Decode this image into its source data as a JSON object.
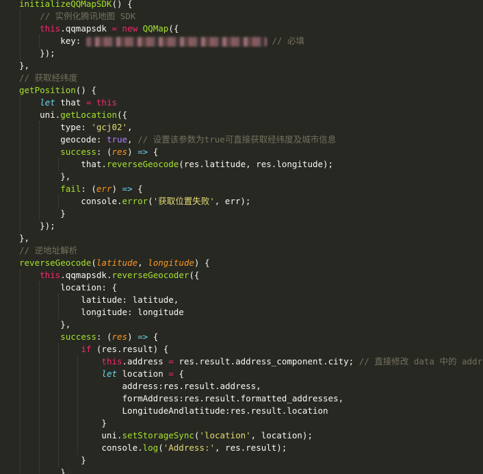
{
  "editor": {
    "theme_colors": {
      "background": "#272822",
      "keyword": "#f92672",
      "function": "#a6e22e",
      "string": "#e6db74",
      "comment": "#75715e",
      "boolean": "#ae81ff",
      "storage": "#66d9ef",
      "parameter": "#fd971f",
      "text": "#f8f8f2"
    },
    "lines": [
      [
        {
          "t": "fn",
          "v": "initializeQQMapSDK"
        },
        {
          "t": "plain",
          "v": "() {"
        }
      ],
      [
        {
          "t": "plain",
          "v": "    "
        },
        {
          "t": "cm",
          "v": "// 实例化腾讯地图 SDK"
        }
      ],
      [
        {
          "t": "plain",
          "v": "    "
        },
        {
          "t": "kw",
          "v": "this"
        },
        {
          "t": "plain",
          "v": ".qqmapsdk "
        },
        {
          "t": "kw",
          "v": "="
        },
        {
          "t": "plain",
          "v": " "
        },
        {
          "t": "kw",
          "v": "new"
        },
        {
          "t": "plain",
          "v": " "
        },
        {
          "t": "fn",
          "v": "QQMap"
        },
        {
          "t": "plain",
          "v": "({"
        }
      ],
      [
        {
          "t": "plain",
          "v": "        key: "
        },
        {
          "t": "redact",
          "v": "redacted key"
        },
        {
          "t": "plain",
          "v": " "
        },
        {
          "t": "cm",
          "v": "// 必填"
        }
      ],
      [
        {
          "t": "plain",
          "v": "    });"
        }
      ],
      [
        {
          "t": "plain",
          "v": "},"
        }
      ],
      [
        {
          "t": "cm",
          "v": "// 获取经纬度"
        }
      ],
      [
        {
          "t": "fn",
          "v": "getPosition"
        },
        {
          "t": "plain",
          "v": "() {"
        }
      ],
      [
        {
          "t": "plain",
          "v": "    "
        },
        {
          "t": "sto",
          "v": "let"
        },
        {
          "t": "plain",
          "v": " that "
        },
        {
          "t": "kw",
          "v": "="
        },
        {
          "t": "plain",
          "v": " "
        },
        {
          "t": "kw",
          "v": "this"
        }
      ],
      [
        {
          "t": "plain",
          "v": "    uni."
        },
        {
          "t": "fn",
          "v": "getLocation"
        },
        {
          "t": "plain",
          "v": "({"
        }
      ],
      [
        {
          "t": "plain",
          "v": "        type: "
        },
        {
          "t": "str",
          "v": "'gcj02'"
        },
        {
          "t": "plain",
          "v": ","
        }
      ],
      [
        {
          "t": "plain",
          "v": "        geocode: "
        },
        {
          "t": "bool",
          "v": "true"
        },
        {
          "t": "plain",
          "v": ", "
        },
        {
          "t": "cm",
          "v": "// 设置该参数为true可直接获取经纬度及城市信息"
        }
      ],
      [
        {
          "t": "plain",
          "v": "        "
        },
        {
          "t": "fn",
          "v": "success"
        },
        {
          "t": "plain",
          "v": ": ("
        },
        {
          "t": "par",
          "v": "res"
        },
        {
          "t": "plain",
          "v": ") "
        },
        {
          "t": "sto",
          "v": "=>"
        },
        {
          "t": "plain",
          "v": " {"
        }
      ],
      [
        {
          "t": "plain",
          "v": "            that."
        },
        {
          "t": "fn",
          "v": "reverseGeocode"
        },
        {
          "t": "plain",
          "v": "(res.latitude, res.longitude);"
        }
      ],
      [
        {
          "t": "plain",
          "v": "        },"
        }
      ],
      [
        {
          "t": "plain",
          "v": "        "
        },
        {
          "t": "fn",
          "v": "fail"
        },
        {
          "t": "plain",
          "v": ": ("
        },
        {
          "t": "par",
          "v": "err"
        },
        {
          "t": "plain",
          "v": ") "
        },
        {
          "t": "sto",
          "v": "=>"
        },
        {
          "t": "plain",
          "v": " {"
        }
      ],
      [
        {
          "t": "plain",
          "v": "            console."
        },
        {
          "t": "fn",
          "v": "error"
        },
        {
          "t": "plain",
          "v": "("
        },
        {
          "t": "str",
          "v": "'获取位置失败'"
        },
        {
          "t": "plain",
          "v": ", err);"
        }
      ],
      [
        {
          "t": "plain",
          "v": "        }"
        }
      ],
      [
        {
          "t": "plain",
          "v": "    });"
        }
      ],
      [
        {
          "t": "plain",
          "v": "},"
        }
      ],
      [
        {
          "t": "cm",
          "v": "// 逆地址解析"
        }
      ],
      [
        {
          "t": "fn",
          "v": "reverseGeocode"
        },
        {
          "t": "plain",
          "v": "("
        },
        {
          "t": "par",
          "v": "latitude"
        },
        {
          "t": "plain",
          "v": ", "
        },
        {
          "t": "par",
          "v": "longitude"
        },
        {
          "t": "plain",
          "v": ") {"
        }
      ],
      [
        {
          "t": "plain",
          "v": "    "
        },
        {
          "t": "kw",
          "v": "this"
        },
        {
          "t": "plain",
          "v": ".qqmapsdk."
        },
        {
          "t": "fn",
          "v": "reverseGeocoder"
        },
        {
          "t": "plain",
          "v": "({"
        }
      ],
      [
        {
          "t": "plain",
          "v": "        location: {"
        }
      ],
      [
        {
          "t": "plain",
          "v": "            latitude: latitude,"
        }
      ],
      [
        {
          "t": "plain",
          "v": "            longitude: longitude"
        }
      ],
      [
        {
          "t": "plain",
          "v": "        },"
        }
      ],
      [
        {
          "t": "plain",
          "v": "        "
        },
        {
          "t": "fn",
          "v": "success"
        },
        {
          "t": "plain",
          "v": ": ("
        },
        {
          "t": "par",
          "v": "res"
        },
        {
          "t": "plain",
          "v": ") "
        },
        {
          "t": "sto",
          "v": "=>"
        },
        {
          "t": "plain",
          "v": " {"
        }
      ],
      [
        {
          "t": "plain",
          "v": "            "
        },
        {
          "t": "kw",
          "v": "if"
        },
        {
          "t": "plain",
          "v": " (res.result) {"
        }
      ],
      [
        {
          "t": "plain",
          "v": "                "
        },
        {
          "t": "kw",
          "v": "this"
        },
        {
          "t": "plain",
          "v": ".address "
        },
        {
          "t": "kw",
          "v": "="
        },
        {
          "t": "plain",
          "v": " res.result.address_component.city; "
        },
        {
          "t": "cm",
          "v": "// 直接修改 data 中的 address"
        }
      ],
      [
        {
          "t": "plain",
          "v": "                "
        },
        {
          "t": "sto",
          "v": "let"
        },
        {
          "t": "plain",
          "v": " location "
        },
        {
          "t": "kw",
          "v": "="
        },
        {
          "t": "plain",
          "v": " {"
        }
      ],
      [
        {
          "t": "plain",
          "v": "                    address:res.result.address,"
        }
      ],
      [
        {
          "t": "plain",
          "v": "                    formAddress:res.result.formatted_addresses,"
        }
      ],
      [
        {
          "t": "plain",
          "v": "                    LongitudeAndlatitude:res.result.location"
        }
      ],
      [
        {
          "t": "plain",
          "v": "                }"
        }
      ],
      [
        {
          "t": "plain",
          "v": "                uni."
        },
        {
          "t": "fn",
          "v": "setStorageSync"
        },
        {
          "t": "plain",
          "v": "("
        },
        {
          "t": "str",
          "v": "'location'"
        },
        {
          "t": "plain",
          "v": ", location);"
        }
      ],
      [
        {
          "t": "plain",
          "v": "                console."
        },
        {
          "t": "fn",
          "v": "log"
        },
        {
          "t": "plain",
          "v": "("
        },
        {
          "t": "str",
          "v": "'Address:'"
        },
        {
          "t": "plain",
          "v": ", res.result);"
        }
      ],
      [
        {
          "t": "plain",
          "v": "            }"
        }
      ],
      [
        {
          "t": "plain",
          "v": "        },"
        }
      ]
    ]
  }
}
